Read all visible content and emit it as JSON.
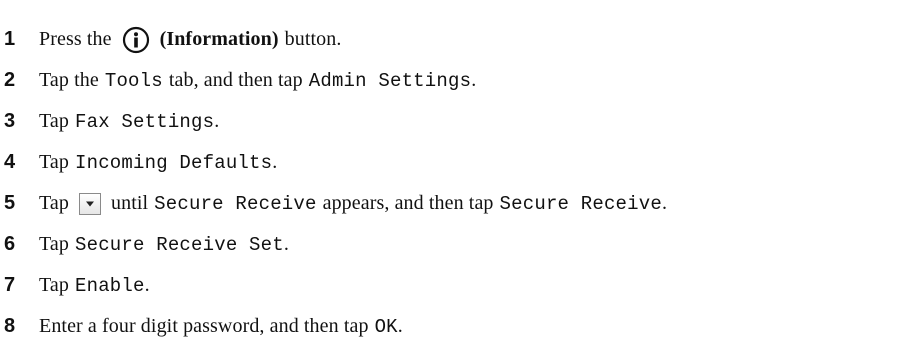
{
  "steps": [
    {
      "number": "1",
      "t1": "Press the",
      "t2": "(Information)",
      "t3": "button."
    },
    {
      "number": "2",
      "t1": "Tap the",
      "t2": "Tools",
      "t3": "tab, and then tap",
      "t4": "Admin Settings",
      "t5": "."
    },
    {
      "number": "3",
      "t1": "Tap",
      "t2": "Fax Settings",
      "t3": "."
    },
    {
      "number": "4",
      "t1": "Tap",
      "t2": "Incoming Defaults",
      "t3": "."
    },
    {
      "number": "5",
      "t1": "Tap",
      "t2": "until",
      "t3": "Secure Receive",
      "t4": "appears, and then tap",
      "t5": "Secure Receive",
      "t6": "."
    },
    {
      "number": "6",
      "t1": "Tap",
      "t2": "Secure Receive Set",
      "t3": "."
    },
    {
      "number": "7",
      "t1": "Tap",
      "t2": "Enable",
      "t3": "."
    },
    {
      "number": "8",
      "t1": "Enter a four digit password, and then tap",
      "t2": "OK",
      "t3": "."
    }
  ],
  "icons": {
    "step1": "information-icon",
    "step5": "scroll-down-icon"
  },
  "colors": {
    "text": "#111111",
    "background": "#ffffff"
  }
}
